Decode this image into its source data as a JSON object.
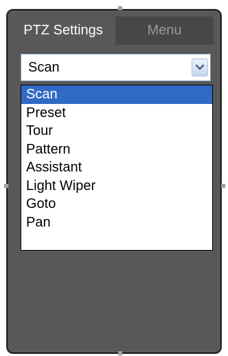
{
  "tabs": [
    {
      "label": "PTZ Settings",
      "active": true
    },
    {
      "label": "Menu",
      "active": false
    }
  ],
  "mode_select": {
    "value": "Scan",
    "options": [
      "Scan",
      "Preset",
      "Tour",
      "Pattern",
      "Assistant",
      "Light Wiper",
      "Goto",
      "Pan"
    ],
    "highlighted": "Scan"
  },
  "colors": {
    "panel": "#585858",
    "highlight": "#316ac5"
  },
  "icons": {
    "dropdown": "chevron-down-icon"
  }
}
